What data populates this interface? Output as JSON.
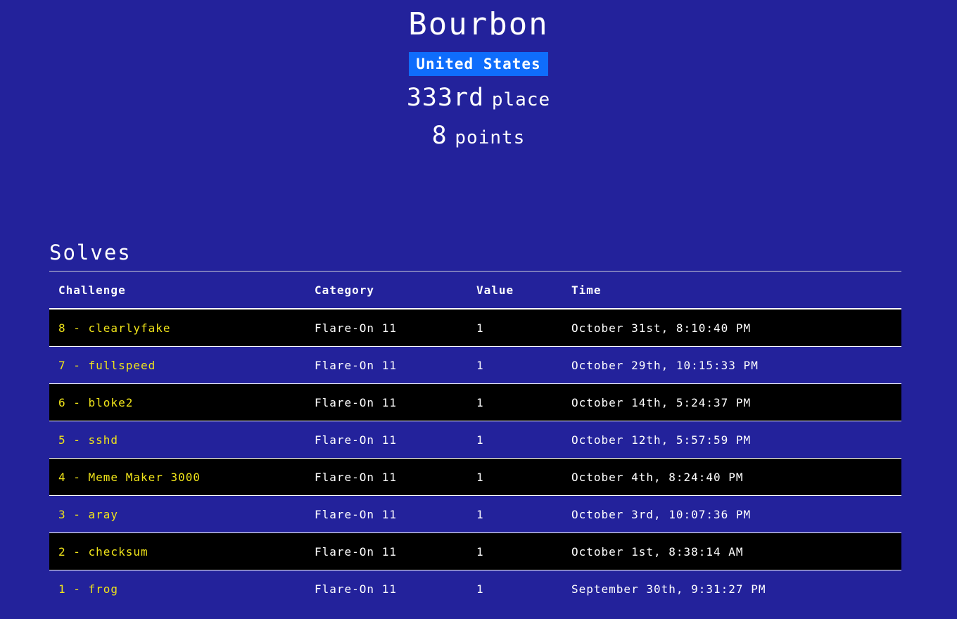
{
  "team": {
    "name": "Bourbon",
    "country": "United States",
    "place_number": "333rd",
    "place_label": "place",
    "points_number": "8",
    "points_label": "points"
  },
  "solves": {
    "title": "Solves",
    "columns": [
      "Challenge",
      "Category",
      "Value",
      "Time"
    ],
    "rows": [
      {
        "challenge": "8 - clearlyfake",
        "category": "Flare-On 11",
        "value": "1",
        "time": "October 31st, 8:10:40 PM"
      },
      {
        "challenge": "7 - fullspeed",
        "category": "Flare-On 11",
        "value": "1",
        "time": "October 29th, 10:15:33 PM"
      },
      {
        "challenge": "6 - bloke2",
        "category": "Flare-On 11",
        "value": "1",
        "time": "October 14th, 5:24:37 PM"
      },
      {
        "challenge": "5 - sshd",
        "category": "Flare-On 11",
        "value": "1",
        "time": "October 12th, 5:57:59 PM"
      },
      {
        "challenge": "4 - Meme Maker 3000",
        "category": "Flare-On 11",
        "value": "1",
        "time": "October 4th, 8:24:40 PM"
      },
      {
        "challenge": "3 - aray",
        "category": "Flare-On 11",
        "value": "1",
        "time": "October 3rd, 10:07:36 PM"
      },
      {
        "challenge": "2 - checksum",
        "category": "Flare-On 11",
        "value": "1",
        "time": "October 1st, 8:38:14 AM"
      },
      {
        "challenge": "1 - frog",
        "category": "Flare-On 11",
        "value": "1",
        "time": "September 30th, 9:31:27 PM"
      }
    ]
  },
  "colors": {
    "background": "#23229b",
    "country_badge": "#0f6dfc",
    "challenge_link": "#f0e419",
    "striped_row": "#000000",
    "text": "#ffffff"
  }
}
